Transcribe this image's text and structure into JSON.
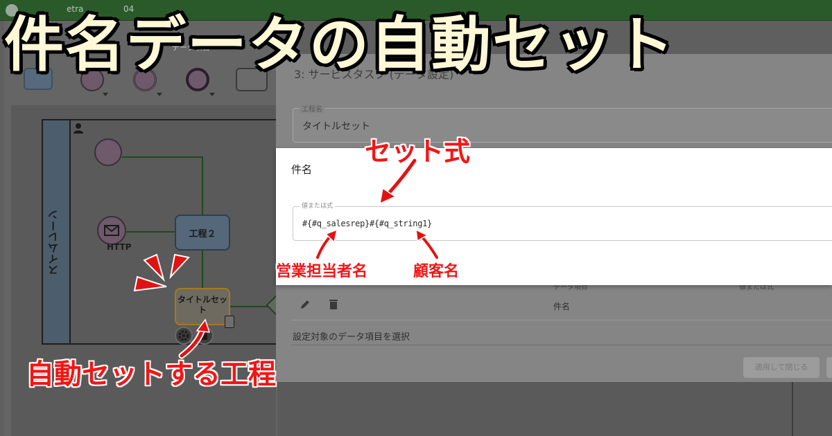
{
  "overlay": {
    "title": "件名データの自動セット",
    "annotations": {
      "set_expression": "セット式",
      "sales_rep_name": "営業担当者名",
      "customer_name": "顧客名",
      "auto_set_step": "自動セットする工程"
    },
    "colors": {
      "title_fill": "#fff8d6",
      "title_outline": "#000000",
      "annotation_red": "#f21616"
    }
  },
  "app": {
    "name": "etra",
    "version": "04",
    "subtitle": "データ項目"
  },
  "canvas": {
    "swimlane_label": "スイムレーン",
    "http_event_label": "HTTP",
    "task_step2": "工程２",
    "task_title_set": "タイトルセット"
  },
  "dialog": {
    "title": "3: サービスタスク (データ設定)",
    "step_name_legend": "工程名",
    "step_name_value": "タイトルセット",
    "section_label": "件名",
    "value_legend": "値または式",
    "value_expression": "#{#q_salesrep}#{#q_string1}",
    "table": {
      "column_data_item": "データ項目",
      "column_value": "値または式",
      "row_data_item": "件名"
    },
    "select_prompt": "設定対象のデータ項目を選択",
    "apply_close_button": "適用して閉じる"
  },
  "icons": [
    "person-icon",
    "mail-icon",
    "calculator-icon",
    "gear-icon",
    "trash-icon",
    "pencil-icon"
  ]
}
